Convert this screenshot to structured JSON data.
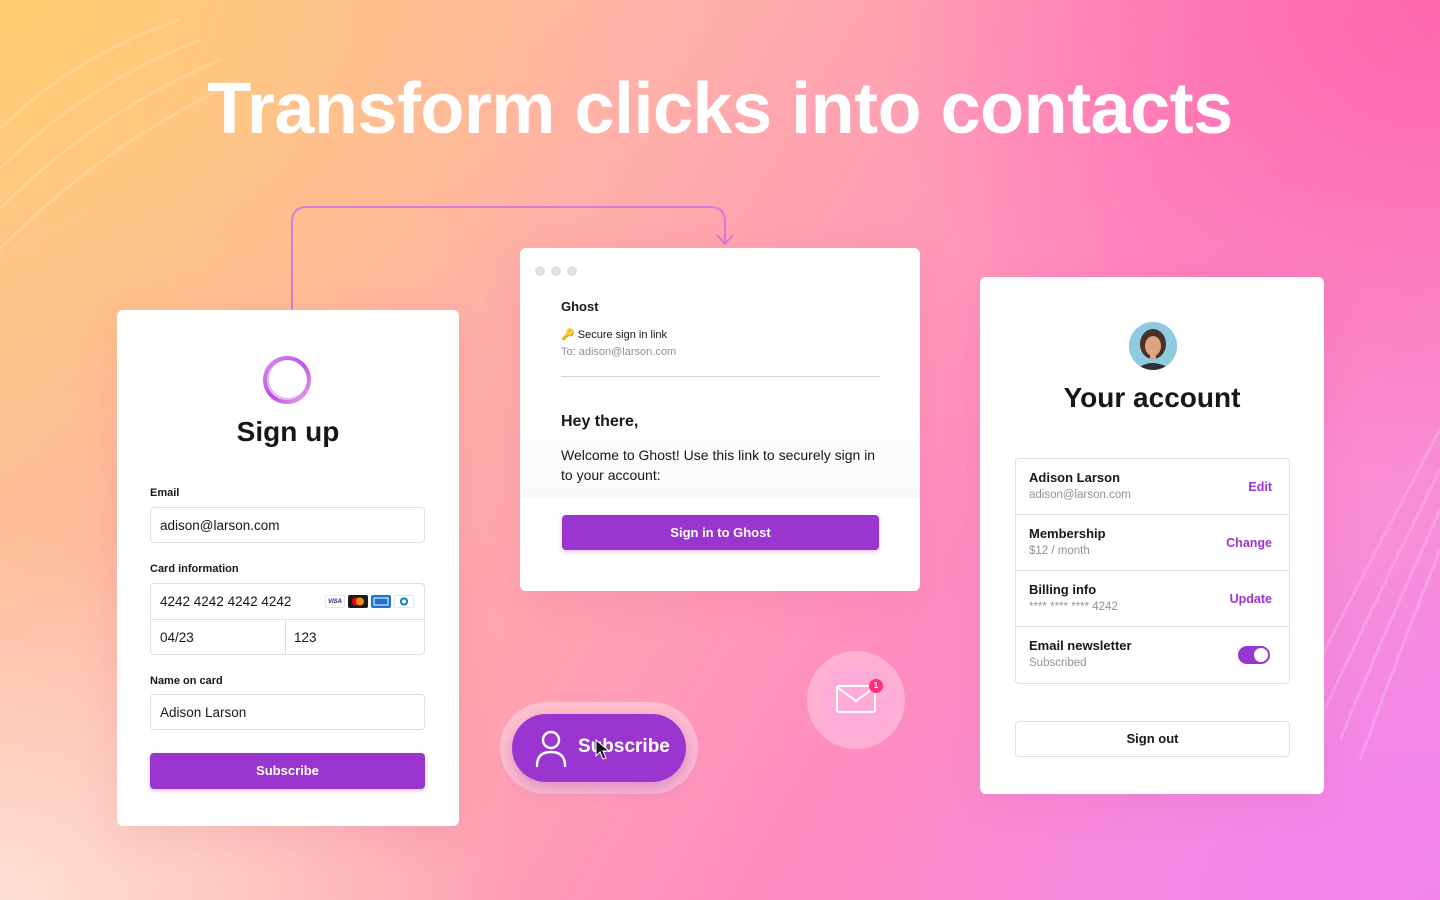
{
  "hero": {
    "title": "Transform clicks into contacts"
  },
  "signup": {
    "title": "Sign up",
    "email_label": "Email",
    "email_value": "adison@larson.com",
    "card_label": "Card information",
    "card_number": "4242 4242 4242 4242",
    "card_expiry": "04/23",
    "card_cvc": "123",
    "card_brands": [
      "VISA",
      "mastercard",
      "amex",
      "diners"
    ],
    "name_label": "Name on card",
    "name_value": "Adison Larson",
    "subscribe_label": "Subscribe"
  },
  "email": {
    "sender": "Ghost",
    "subject_icon": "key-icon",
    "subject": "Secure sign in link",
    "to": "To: adison@larson.com",
    "greeting": "Hey there,",
    "body": "Welcome to Ghost! Use this link to securely sign in to your account:",
    "button_label": "Sign in to Ghost"
  },
  "account": {
    "title": "Your account",
    "rows": [
      {
        "title": "Adison Larson",
        "subtitle": "adison@larson.com",
        "action": "Edit"
      },
      {
        "title": "Membership",
        "subtitle": "$12 / month",
        "action": "Change"
      },
      {
        "title": "Billing info",
        "subtitle": "**** **** **** 4242",
        "action": "Update"
      },
      {
        "title": "Email newsletter",
        "subtitle": "Subscribed",
        "toggle_on": true
      }
    ],
    "signout_label": "Sign out"
  },
  "subscribe_pill": {
    "label": "Subscribe",
    "icon": "user-icon"
  },
  "mail_notification": {
    "icon": "envelope-icon",
    "count": "1"
  },
  "colors": {
    "accent": "#9b35cf",
    "badge": "#ff2f7a",
    "text": "#15171a",
    "muted": "#8e9399"
  }
}
